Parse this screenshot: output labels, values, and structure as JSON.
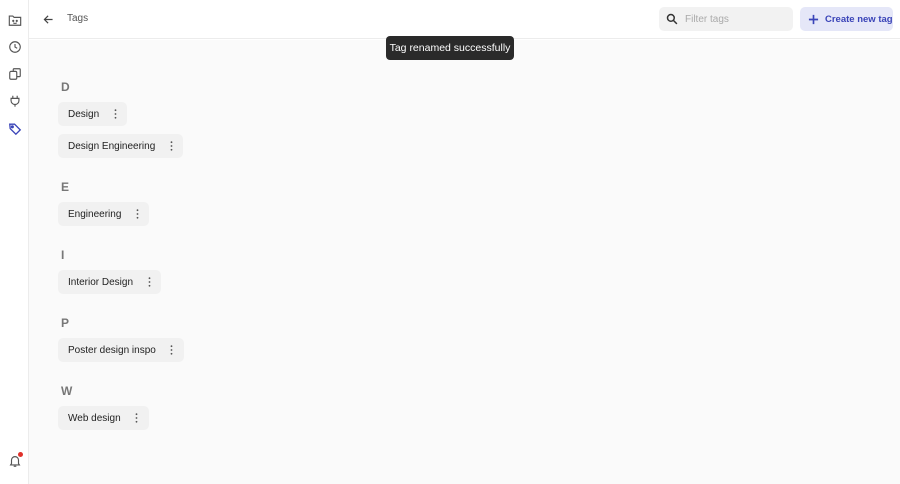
{
  "header": {
    "title": "Tags",
    "search_placeholder": "Filter tags",
    "create_label": "Create new tag"
  },
  "toast": {
    "message": "Tag renamed successfully"
  },
  "sidebar": {
    "icons": [
      "smiley-folder-icon",
      "history-icon",
      "copy-icon",
      "plug-icon",
      "tag-icon",
      "bell-icon"
    ],
    "active": "tag-icon",
    "notification_color": "#e0312b"
  },
  "groups": [
    {
      "letter": "D",
      "tags": [
        "Design",
        "Design Engineering"
      ]
    },
    {
      "letter": "E",
      "tags": [
        "Engineering"
      ]
    },
    {
      "letter": "I",
      "tags": [
        "Interior Design"
      ]
    },
    {
      "letter": "P",
      "tags": [
        "Poster design inspo"
      ]
    },
    {
      "letter": "W",
      "tags": [
        "Web design"
      ]
    }
  ],
  "colors": {
    "accent": "#3a44b8",
    "accent_bg": "#e5e7f8",
    "toast_bg": "#2a2a2a"
  }
}
